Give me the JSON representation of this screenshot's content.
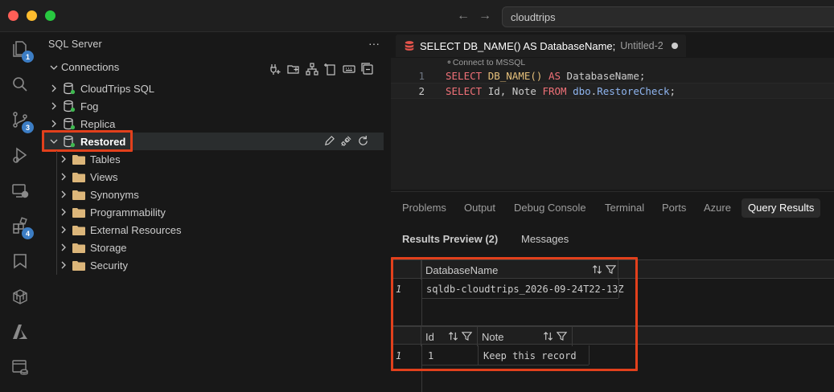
{
  "titlebar": {
    "search_text": "cloudtrips"
  },
  "activity": {
    "explorer_badge": "1",
    "scm_badge": "3",
    "extensions_badge": "4"
  },
  "sidebar": {
    "title": "SQL Server",
    "more": "···",
    "connections_label": "Connections",
    "connections": [
      {
        "label": "CloudTrips SQL"
      },
      {
        "label": "Fog"
      },
      {
        "label": "Replica"
      },
      {
        "label": "Restored"
      }
    ],
    "folders": [
      {
        "label": "Tables"
      },
      {
        "label": "Views"
      },
      {
        "label": "Synonyms"
      },
      {
        "label": "Programmability"
      },
      {
        "label": "External Resources"
      },
      {
        "label": "Storage"
      },
      {
        "label": "Security"
      }
    ]
  },
  "editor": {
    "tab_title": "SELECT DB_NAME() AS DatabaseName;",
    "tab_subtitle": "Untitled-2",
    "codelens": "Connect to MSSQL",
    "lines": [
      {
        "num": "1",
        "kw1": "SELECT",
        "fn": "DB_NAME()",
        "kw2": "AS",
        "rest": "DatabaseName;"
      },
      {
        "num": "2",
        "kw1": "SELECT",
        "mid": "Id, Note",
        "kw2": "FROM",
        "obj1": "dbo",
        "dot": ".",
        "obj2": "RestoreCheck",
        "end": ";"
      }
    ]
  },
  "panel": {
    "tabs": [
      "Problems",
      "Output",
      "Debug Console",
      "Terminal",
      "Ports",
      "Azure",
      "Query Results"
    ],
    "active_tab": "Query Results",
    "subtabs": [
      "Results Preview (2)",
      "Messages"
    ],
    "result1": {
      "columns": [
        "DatabaseName"
      ],
      "rows": [
        {
          "num": "1",
          "values": [
            "sqldb-cloudtrips_2026-09-24T22-13Z"
          ]
        }
      ]
    },
    "result2": {
      "columns": [
        "Id",
        "Note"
      ],
      "rows": [
        {
          "num": "1",
          "values": [
            "1",
            "Keep this record"
          ]
        }
      ]
    }
  },
  "colors": {
    "accent_red": "#e2401c",
    "badge_blue": "#3c7dc4",
    "keyword": "#f07178",
    "function": "#e6c07b"
  }
}
